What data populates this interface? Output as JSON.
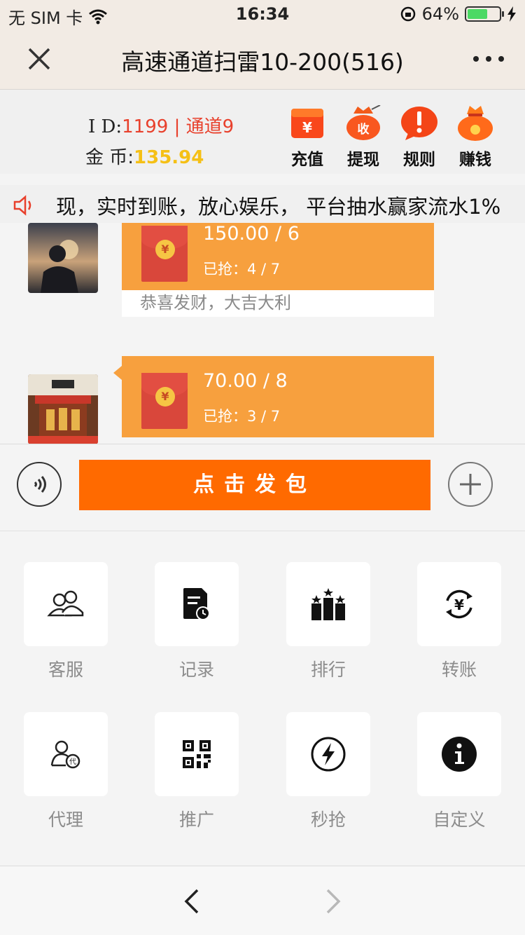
{
  "status": {
    "carrier": "无 SIM 卡",
    "time": "16:34",
    "battery": "64%",
    "battery_level": 0.64
  },
  "nav": {
    "title": "高速通道扫雷10-200(516)"
  },
  "account": {
    "id_label": "I D:",
    "id_value": "1199 | 通道9",
    "coin_label": "金 币:",
    "coin_value": "135.94",
    "actions": [
      {
        "label": "充值",
        "icon": "recharge-icon"
      },
      {
        "label": "提现",
        "icon": "withdraw-icon"
      },
      {
        "label": "规则",
        "icon": "rules-icon"
      },
      {
        "label": "赚钱",
        "icon": "earn-icon"
      }
    ]
  },
  "notice": {
    "text": "现，实时到账，放心娱乐， 平台抽水赢家流水1%"
  },
  "chat": {
    "messages": [
      {
        "amount": "150.00 / 6",
        "grabbed": "已抢：4 / 7",
        "wish": "恭喜发财，大吉大利"
      },
      {
        "amount": "70.00 / 8",
        "grabbed": "已抢：3 / 7",
        "wish": ""
      }
    ]
  },
  "input": {
    "send_label": "点击发包"
  },
  "grid": {
    "items": [
      {
        "label": "客服",
        "icon": "customer-service-icon"
      },
      {
        "label": "记录",
        "icon": "record-icon"
      },
      {
        "label": "排行",
        "icon": "ranking-icon"
      },
      {
        "label": "转账",
        "icon": "transfer-icon"
      },
      {
        "label": "代理",
        "icon": "agent-icon"
      },
      {
        "label": "推广",
        "icon": "qr-code-icon"
      },
      {
        "label": "秒抢",
        "icon": "flash-icon"
      },
      {
        "label": "自定义",
        "icon": "info-icon"
      }
    ]
  },
  "colors": {
    "accent": "#ff6a00",
    "bubble": "#f7a03e",
    "id_value": "#e8402c",
    "coin_value": "#f5c016"
  }
}
